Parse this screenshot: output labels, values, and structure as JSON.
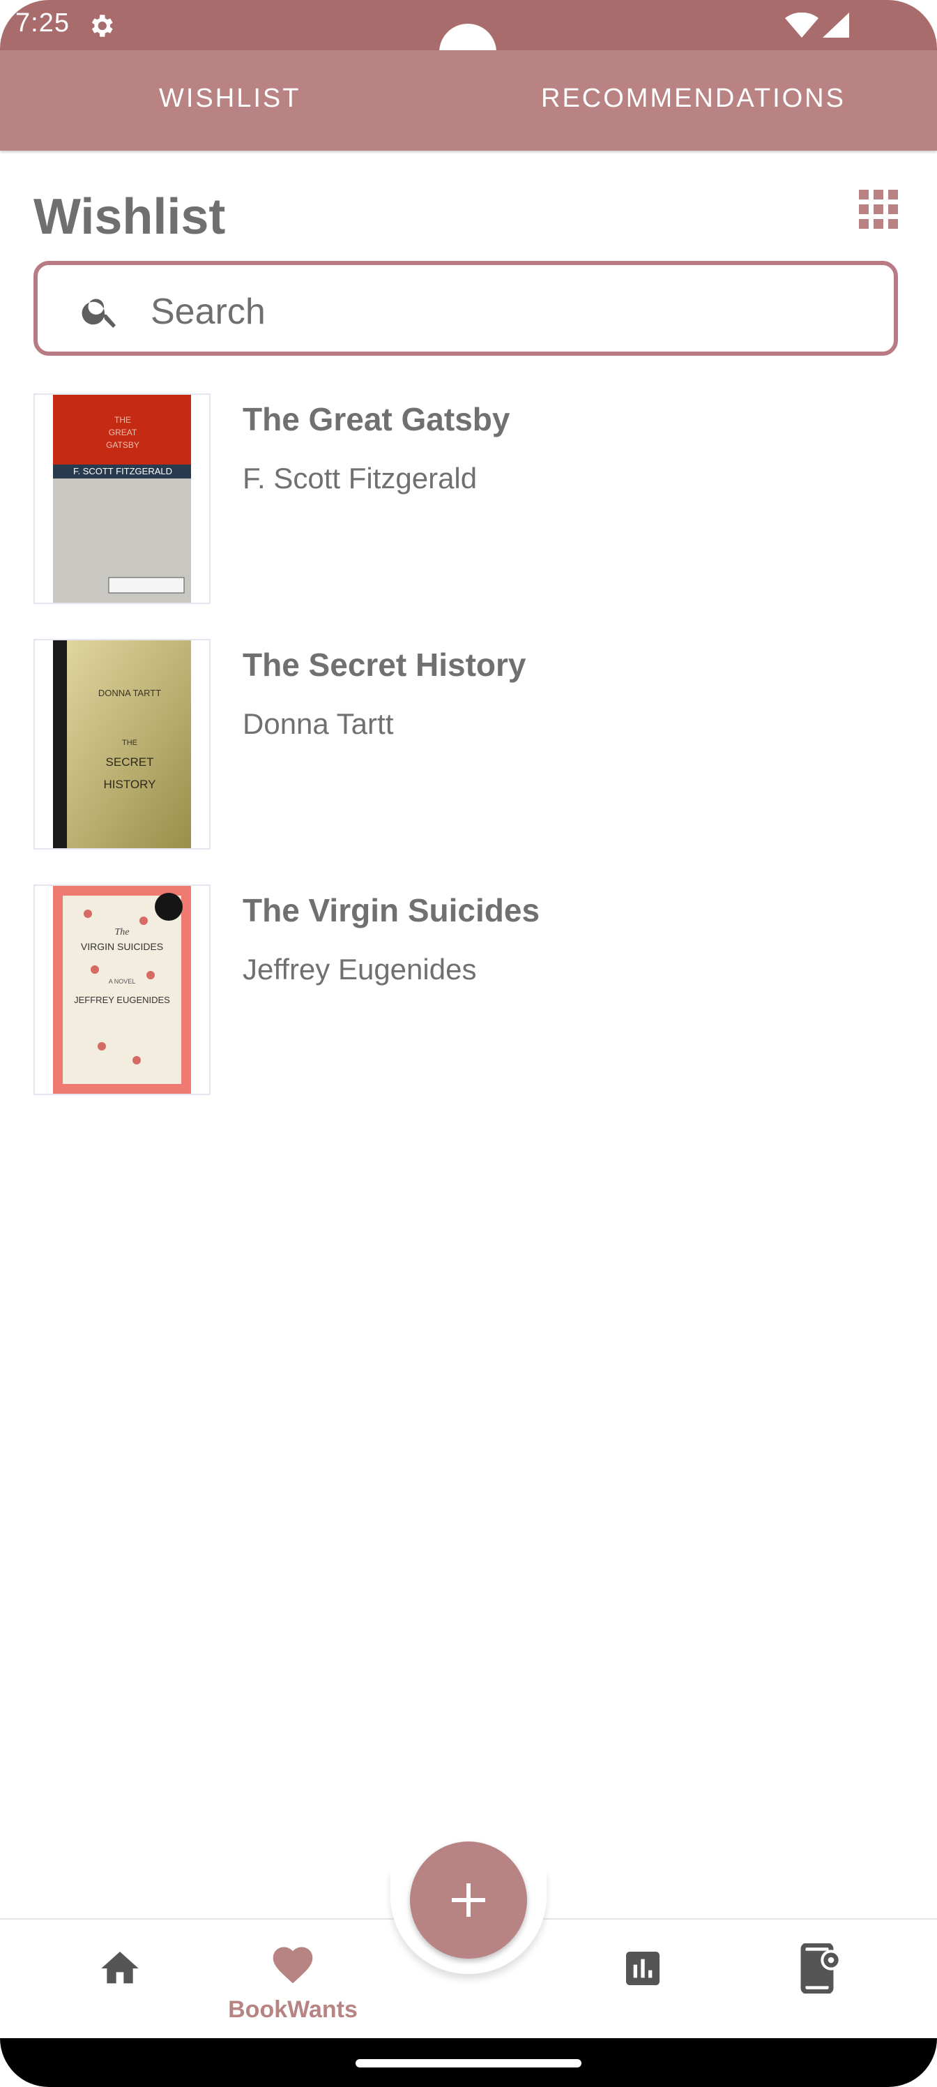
{
  "status_bar": {
    "time": "7:25"
  },
  "tabs": [
    {
      "label": "WISHLIST"
    },
    {
      "label": "RECOMMENDATIONS"
    }
  ],
  "page": {
    "title": "Wishlist"
  },
  "search": {
    "placeholder": "Search",
    "value": ""
  },
  "books": [
    {
      "title": "The Great Gatsby",
      "author": "F. Scott Fitzgerald",
      "cover_text": [
        "THE",
        "GREAT",
        "GATSBY",
        "F. SCOTT FITZGERALD"
      ]
    },
    {
      "title": "The Secret History",
      "author": "Donna Tartt",
      "cover_text": [
        "DONNA TARTT",
        "THE",
        "SECRET",
        "HISTORY"
      ]
    },
    {
      "title": "The Virgin Suicides",
      "author": "Jeffrey Eugenides",
      "cover_text": [
        "The",
        "VIRGIN SUICIDES",
        "A NOVEL",
        "JEFFREY EUGENIDES"
      ]
    }
  ],
  "bottom_nav": {
    "items": [
      {
        "icon": "home-icon"
      },
      {
        "icon": "heart-icon",
        "label": "BookWants"
      },
      {
        "icon": "stats-icon"
      },
      {
        "icon": "device-settings-icon"
      }
    ]
  },
  "colors": {
    "primary": "#b98383",
    "status_bar": "#a86c6c",
    "text_gray": "#707070"
  }
}
